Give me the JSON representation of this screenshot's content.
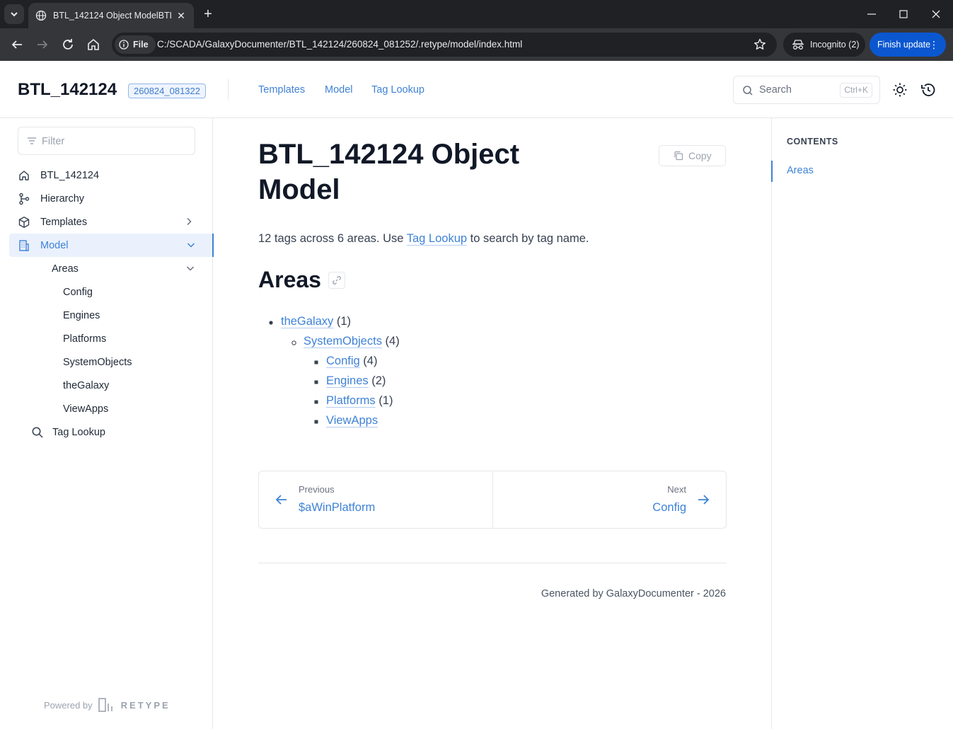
{
  "browser": {
    "tab_title": "BTL_142124 Object ModelBTL_142124",
    "url": "C:/SCADA/GalaxyDocumenter/BTL_142124/260824_081252/.retype/model/index.html",
    "file_chip": "File",
    "incognito_label": "Incognito (2)",
    "update_label": "Finish update"
  },
  "header": {
    "brand": "BTL_142124",
    "version": "260824_081322",
    "nav": [
      "Templates",
      "Model",
      "Tag Lookup"
    ],
    "search_placeholder": "Search",
    "search_shortcut": "Ctrl+K"
  },
  "sidebar": {
    "filter_placeholder": "Filter",
    "items": [
      {
        "label": "BTL_142124",
        "icon": "home-icon"
      },
      {
        "label": "Hierarchy",
        "icon": "git-branch-icon"
      },
      {
        "label": "Templates",
        "icon": "package-icon"
      },
      {
        "label": "Model",
        "icon": "building-icon",
        "active": true
      },
      {
        "label": "Areas"
      },
      {
        "label": "Config"
      },
      {
        "label": "Engines"
      },
      {
        "label": "Platforms"
      },
      {
        "label": "SystemObjects"
      },
      {
        "label": "theGalaxy"
      },
      {
        "label": "ViewApps"
      },
      {
        "label": "Tag Lookup",
        "icon": "search-icon"
      }
    ],
    "powered_by": "Powered by",
    "retype": "RETYPE"
  },
  "main": {
    "title": "BTL_142124 Object Model",
    "copy_label": "Copy",
    "intro_before": "12 tags across 6 areas. Use ",
    "intro_link": "Tag Lookup",
    "intro_after": " to search by tag name.",
    "areas_heading": "Areas",
    "tree": [
      {
        "name": "theGalaxy",
        "count": "(1)"
      },
      {
        "name": "SystemObjects",
        "count": "(4)"
      },
      {
        "name": "Config",
        "count": "(4)"
      },
      {
        "name": "Engines",
        "count": "(2)"
      },
      {
        "name": "Platforms",
        "count": "(1)"
      },
      {
        "name": "ViewApps",
        "count": ""
      }
    ],
    "pager": {
      "prev_label": "Previous",
      "prev_title": "$aWinPlatform",
      "next_label": "Next",
      "next_title": "Config"
    },
    "footer": "Generated by GalaxyDocumenter - 2026"
  },
  "toc": {
    "heading": "CONTENTS",
    "items": [
      "Areas"
    ]
  },
  "colors": {
    "accent": "#3f82d6",
    "chrome_dark": "#202124",
    "chrome_toolbar": "#35363a",
    "update_button": "#0b57d0"
  }
}
